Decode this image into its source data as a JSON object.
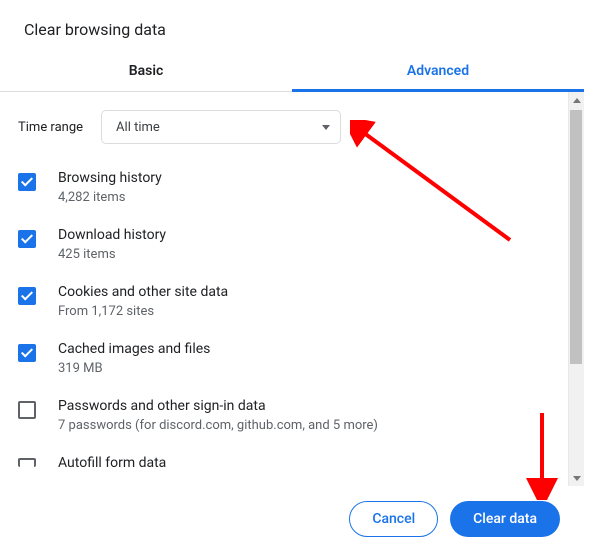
{
  "dialog": {
    "title": "Clear browsing data"
  },
  "tabs": {
    "basic": "Basic",
    "advanced": "Advanced"
  },
  "time_range": {
    "label": "Time range",
    "selected": "All time"
  },
  "items": [
    {
      "title": "Browsing history",
      "sub": "4,282 items",
      "checked": true
    },
    {
      "title": "Download history",
      "sub": "425 items",
      "checked": true
    },
    {
      "title": "Cookies and other site data",
      "sub": "From 1,172 sites",
      "checked": true
    },
    {
      "title": "Cached images and files",
      "sub": "319 MB",
      "checked": true
    },
    {
      "title": "Passwords and other sign-in data",
      "sub": "7 passwords (for discord.com, github.com, and 5 more)",
      "checked": false
    },
    {
      "title": "Autofill form data",
      "sub": "",
      "checked": false
    }
  ],
  "buttons": {
    "cancel": "Cancel",
    "clear": "Clear data"
  }
}
